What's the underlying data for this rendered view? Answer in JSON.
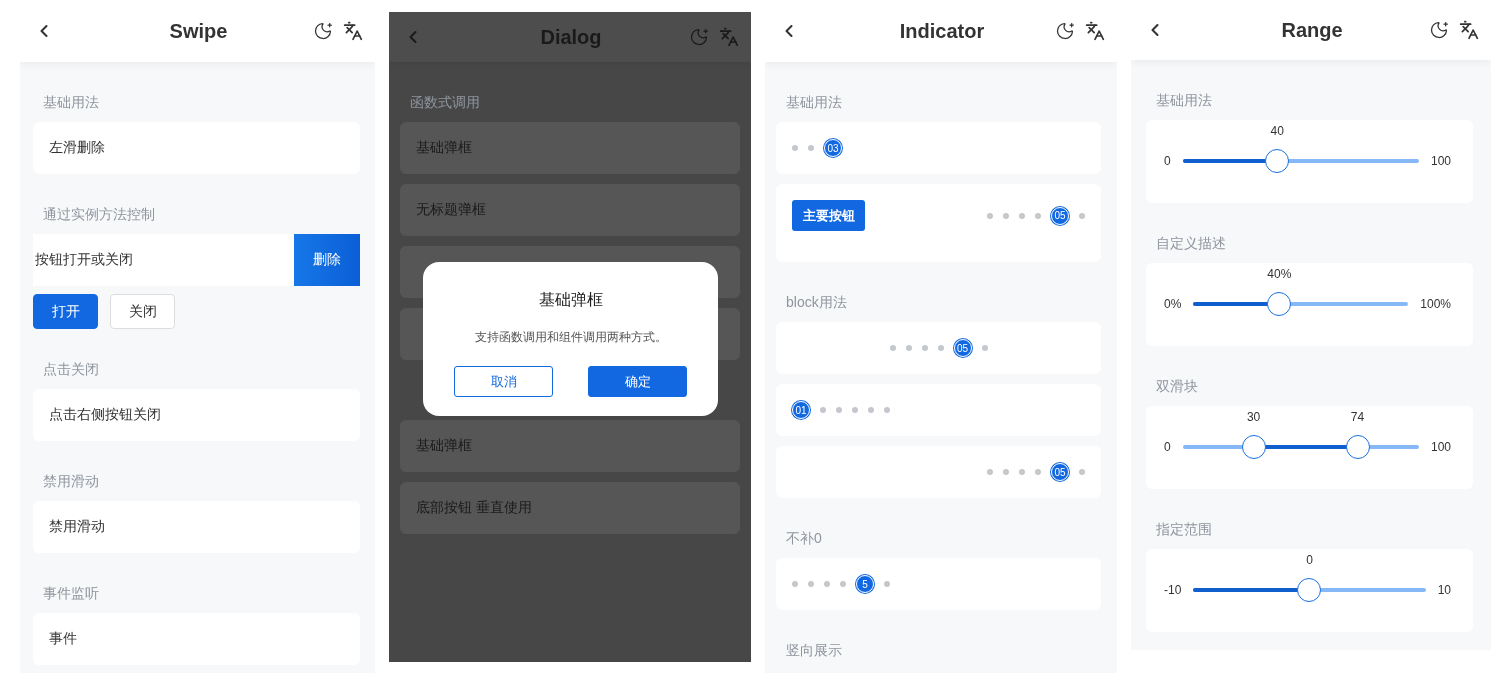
{
  "screens": [
    {
      "kind": "swipe",
      "title": "Swipe",
      "sections": [
        {
          "title": "基础用法",
          "rows": [
            {
              "kind": "cell",
              "text": "左滑删除"
            }
          ]
        },
        {
          "title": "通过实例方法控制",
          "rows": [
            {
              "kind": "swipe",
              "text": "按钮打开或关闭",
              "action": "删除",
              "open": true
            },
            {
              "kind": "buttons",
              "buttons": [
                {
                  "label": "打开",
                  "primary": true
                },
                {
                  "label": "关闭",
                  "primary": false
                }
              ]
            }
          ]
        },
        {
          "title": "点击关闭",
          "rows": [
            {
              "kind": "cell",
              "text": "点击右侧按钮关闭"
            }
          ]
        },
        {
          "title": "禁用滑动",
          "rows": [
            {
              "kind": "cell",
              "text": "禁用滑动"
            }
          ]
        },
        {
          "title": "事件监听",
          "rows": [
            {
              "kind": "cell",
              "text": "事件"
            }
          ]
        }
      ]
    },
    {
      "kind": "dialog",
      "title": "Dialog",
      "sections": [
        {
          "title": "函数式调用",
          "rows": [
            {
              "kind": "cell",
              "text": "基础弹框"
            },
            {
              "kind": "cell",
              "text": "无标题弹框"
            },
            {
              "kind": "cell"
            },
            {
              "kind": "cell"
            }
          ]
        },
        {
          "rows": [
            {
              "kind": "cell",
              "text": "基础弹框"
            },
            {
              "kind": "cell",
              "text": "底部按钮 垂直使用"
            }
          ]
        }
      ],
      "modal": {
        "title": "基础弹框",
        "message": "支持函数调用和组件调用两种方式。",
        "cancel": "取消",
        "confirm": "确定"
      }
    },
    {
      "kind": "indicator",
      "title": "Indicator",
      "sections": [
        {
          "title": "基础用法",
          "rows": [
            {
              "kind": "indicator-start",
              "dots": [
                {
                  "selected": false
                },
                {
                  "selected": false
                },
                {
                  "selected": true,
                  "label": "03"
                }
              ]
            },
            {
              "kind": "button-indicator",
              "button": "主要按钮",
              "dots": [
                {
                  "selected": false
                },
                {
                  "selected": false
                },
                {
                  "selected": false
                },
                {
                  "selected": false
                },
                {
                  "selected": true,
                  "label": "05"
                },
                {
                  "selected": false
                }
              ]
            }
          ]
        },
        {
          "title": "block用法",
          "rows": [
            {
              "kind": "indicator-center",
              "dots": [
                {
                  "selected": false
                },
                {
                  "selected": false
                },
                {
                  "selected": false
                },
                {
                  "selected": false
                },
                {
                  "selected": true,
                  "label": "05"
                },
                {
                  "selected": false
                }
              ]
            },
            {
              "kind": "indicator-start",
              "dots": [
                {
                  "selected": true,
                  "label": "01"
                },
                {
                  "selected": false
                },
                {
                  "selected": false
                },
                {
                  "selected": false
                },
                {
                  "selected": false
                },
                {
                  "selected": false
                }
              ]
            },
            {
              "kind": "indicator-end",
              "dots": [
                {
                  "selected": false
                },
                {
                  "selected": false
                },
                {
                  "selected": false
                },
                {
                  "selected": false
                },
                {
                  "selected": true,
                  "label": "05"
                },
                {
                  "selected": false
                }
              ]
            }
          ]
        },
        {
          "title": "不补0",
          "rows": [
            {
              "kind": "indicator-start",
              "dots": [
                {
                  "selected": false
                },
                {
                  "selected": false
                },
                {
                  "selected": false
                },
                {
                  "selected": false
                },
                {
                  "selected": true,
                  "label": "5"
                },
                {
                  "selected": false
                }
              ]
            }
          ]
        },
        {
          "title": "竖向展示"
        }
      ]
    },
    {
      "kind": "range",
      "title": "Range",
      "sections": [
        {
          "title": "基础用法",
          "rows": [
            {
              "kind": "range",
              "min": "0",
              "max": "100",
              "thumbs": [
                {
                  "label": "40",
                  "level": 0.4
                }
              ]
            }
          ]
        },
        {
          "title": "自定义描述",
          "rows": [
            {
              "kind": "range",
              "min": "0%",
              "max": "100%",
              "thumbs": [
                {
                  "label": "40%",
                  "level": 0.4
                }
              ]
            }
          ]
        },
        {
          "title": "双滑块",
          "rows": [
            {
              "kind": "range",
              "min": "0",
              "max": "100",
              "thumbs": [
                {
                  "label": "30",
                  "level": 0.3
                },
                {
                  "label": "74",
                  "level": 0.74
                }
              ]
            }
          ]
        },
        {
          "title": "指定范围",
          "rows": [
            {
              "kind": "range",
              "min": "-10",
              "max": "10",
              "thumbs": [
                {
                  "label": "0",
                  "level": 0.5
                }
              ]
            }
          ]
        }
      ]
    }
  ]
}
